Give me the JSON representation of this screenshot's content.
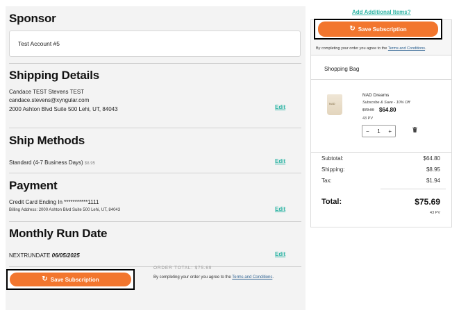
{
  "left": {
    "sponsor": {
      "title": "Sponsor",
      "value": "Test Account #5"
    },
    "shipping": {
      "title": "Shipping Details",
      "name": "Candace TEST Stevens TEST",
      "email": "candace.stevens@xyngular.com",
      "address": "2000 Ashton Blvd Suite 500 Lehi, UT, 84043",
      "edit_label": "Edit"
    },
    "ship_methods": {
      "title": "Ship Methods",
      "method": "Standard (4-7 Business Days)",
      "price": "$8.95",
      "edit_label": "Edit"
    },
    "payment": {
      "title": "Payment",
      "card": "Credit Card Ending In ***********1111",
      "billing": "Billing Address: 2000 Ashton Blvd Suite 500 Lehi, UT, 84043",
      "edit_label": "Edit"
    },
    "run_date": {
      "title": "Monthly Run Date",
      "label": "NEXTRUNDATE",
      "date": "06/05/2025",
      "edit_label": "Edit"
    },
    "footer": {
      "save_label": "Save Subscription",
      "order_total": "ORDER TOTAL: $75.69",
      "agree_text": "By completing your order you agree to the ",
      "terms_link": "Terms and Conditions",
      "agree_end": "."
    }
  },
  "right": {
    "add_items_label": "Add Additional Items?",
    "save_label": "Save Subscription",
    "agree_text": "By completing your order you agree to the ",
    "terms_link": "Terms and Conditions",
    "agree_end": ".",
    "bag_title": "Shopping Bag",
    "product": {
      "name": "NAD Dreams",
      "subtitle": "Subscribe & Save - 10% Off",
      "old_price": "$72.00",
      "new_price": "$64.80",
      "pv": "43 PV",
      "quantity": "1",
      "minus": "−",
      "plus": "+",
      "image_text": "NAD"
    },
    "summary": {
      "subtotal_label": "Subtotal:",
      "subtotal": "$64.80",
      "shipping_label": "Shipping:",
      "shipping": "$8.95",
      "tax_label": "Tax:",
      "tax": "$1.94",
      "total_label": "Total:",
      "total": "$75.69",
      "total_pv": "43 PV"
    }
  },
  "colors": {
    "accent": "#f2762e",
    "link": "#2bb3a3"
  },
  "icons": {
    "refresh": "refresh-icon",
    "trash": "trash-icon"
  }
}
